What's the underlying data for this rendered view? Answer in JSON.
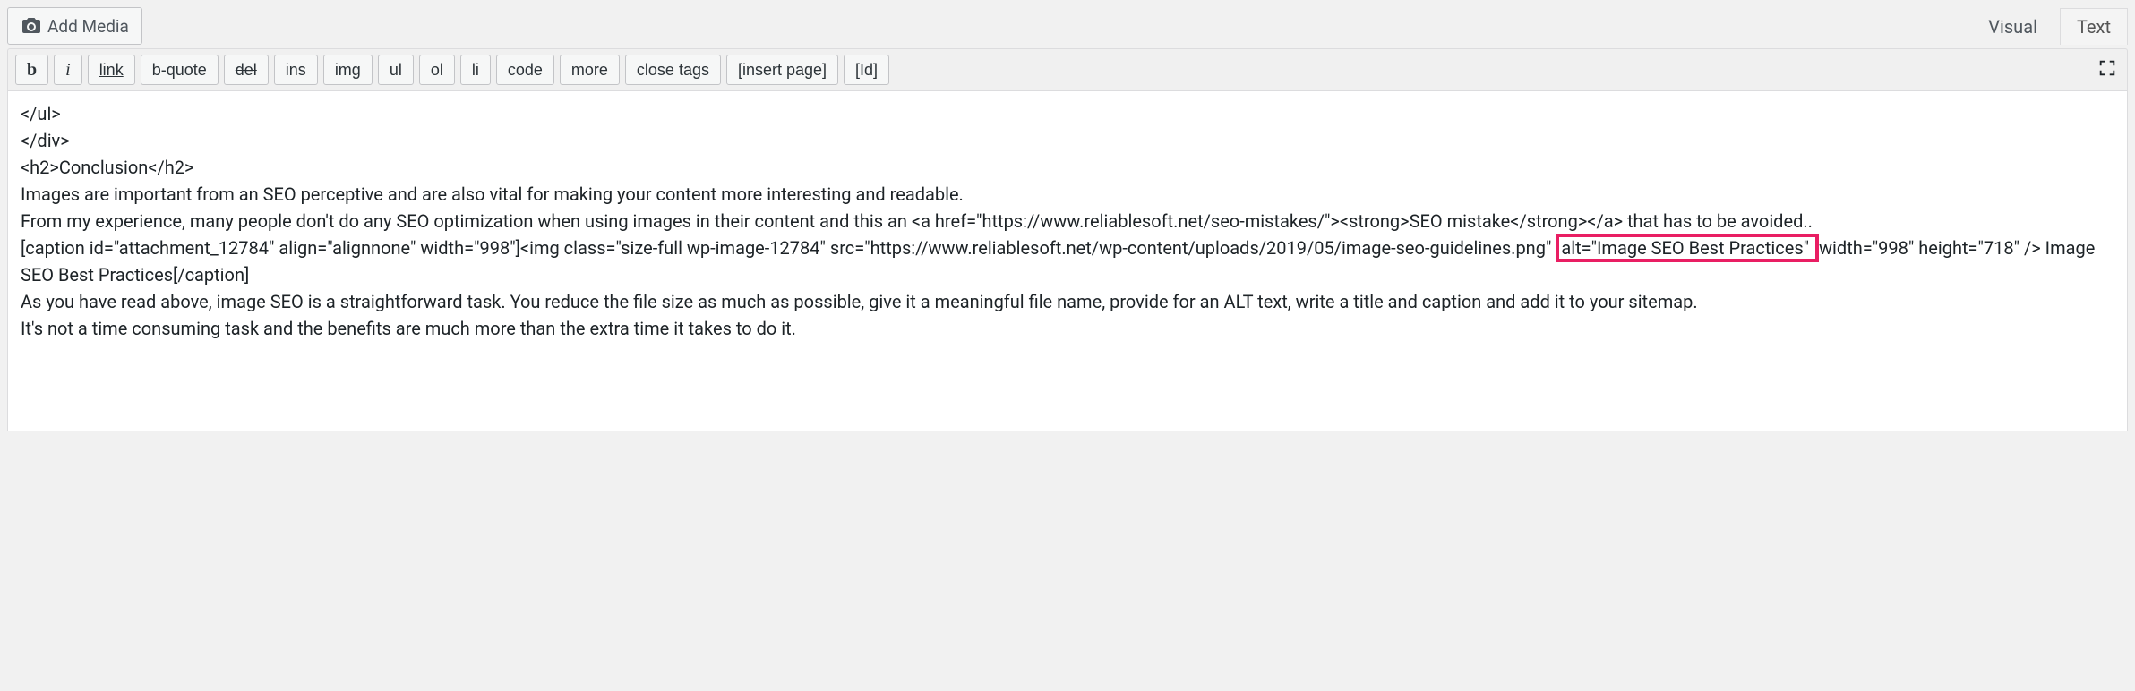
{
  "addMediaLabel": "Add Media",
  "tabs": {
    "visual": "Visual",
    "text": "Text"
  },
  "toolbar": {
    "b": "b",
    "i": "i",
    "link": "link",
    "bquote": "b-quote",
    "del": "del",
    "ins": "ins",
    "img": "img",
    "ul": "ul",
    "ol": "ol",
    "li": "li",
    "code": "code",
    "more": "more",
    "closeTags": "close tags",
    "insertPage": "[insert page]",
    "id": "[Id]"
  },
  "content": {
    "line1": "</ul>",
    "line2": "</div>",
    "line3": "<h2>Conclusion</h2>",
    "line4": "Images are important from an SEO perceptive and are also vital for making your content more interesting and readable.",
    "line5": "",
    "line6": "From my experience, many people don't do any SEO optimization when using images in their content and this an <a href=\"https://www.reliablesoft.net/seo-mistakes/\"><strong>SEO mistake</strong></a> that has to be avoided..",
    "line7": "",
    "line8a": "[caption id=\"attachment_12784\" align=\"alignnone\" width=\"998\"]<img class=\"size-full wp-image-12784\" src=\"https://www.reliablesoft.net/wp-content/uploads/2019/05/image-seo-guidelines.png\" ",
    "line8highlight": "alt=\"Image SEO Best Practices\" ",
    "line8b": "width=\"998\" height=\"718\" /> Image SEO Best Practices[/caption]",
    "line9": "",
    "line10": "As you have read above, image SEO is a straightforward task. You reduce the file size as much as possible, give it a meaningful file name, provide for an ALT text, write a title and caption and add it to your sitemap.",
    "line11": "",
    "line12": "It's not a time consuming task and the benefits are much more than the extra time it takes to do it."
  }
}
